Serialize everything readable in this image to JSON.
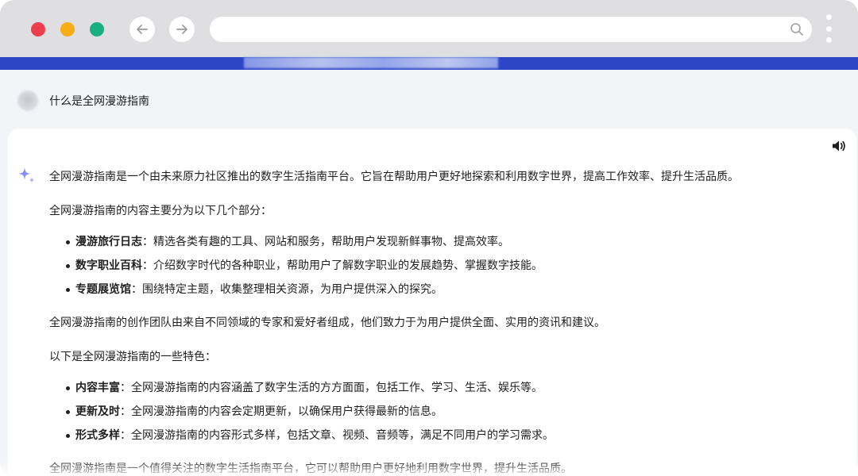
{
  "browser": {
    "controls": [
      "close",
      "minimize",
      "maximize"
    ],
    "url_value": "",
    "icons": {
      "back": "arrow-left-icon",
      "forward": "arrow-right-icon",
      "search": "search-icon",
      "menu": "more-vertical-icon"
    },
    "colors": {
      "red": "#ee3d4c",
      "yellow": "#f7ac14",
      "green": "#17b07e",
      "site_bar": "#2d46c7"
    }
  },
  "question": {
    "text": "什么是全网漫游指南"
  },
  "answer": {
    "intro": "全网漫游指南是一个由未来原力社区推出的数字生活指南平台。它旨在帮助用户更好地探索和利用数字世界，提高工作效率、提升生活品质。",
    "sections_intro": "全网漫游指南的内容主要分为以下几个部分：",
    "sections": [
      {
        "title": "漫游旅行日志",
        "desc": "：精选各类有趣的工具、网站和服务，帮助用户发现新鲜事物、提高效率。"
      },
      {
        "title": "数字职业百科",
        "desc": "：介绍数字时代的各种职业，帮助用户了解数字职业的发展趋势、掌握数字技能。"
      },
      {
        "title": "专题展览馆",
        "desc": "：围绕特定主题，收集整理相关资源，为用户提供深入的探究。"
      }
    ],
    "team": "全网漫游指南的创作团队由来自不同领域的专家和爱好者组成，他们致力于为用户提供全面、实用的资讯和建议。",
    "features_intro": "以下是全网漫游指南的一些特色：",
    "features": [
      {
        "title": "内容丰富",
        "desc": "：全网漫游指南的内容涵盖了数字生活的方方面面，包括工作、学习、生活、娱乐等。"
      },
      {
        "title": "更新及时",
        "desc": "：全网漫游指南的内容会定期更新，以确保用户获得最新的信息。"
      },
      {
        "title": "形式多样",
        "desc": "：全网漫游指南的内容形式多样，包括文章、视频、音频等，满足不同用户的学习需求。"
      }
    ],
    "conclusion": "全网漫游指南是一个值得关注的数字生活指南平台，它可以帮助用户更好地利用数字世界，提升生活品质。",
    "icons": {
      "speaker": "speaker-icon",
      "assistant": "sparkle-icon"
    }
  }
}
